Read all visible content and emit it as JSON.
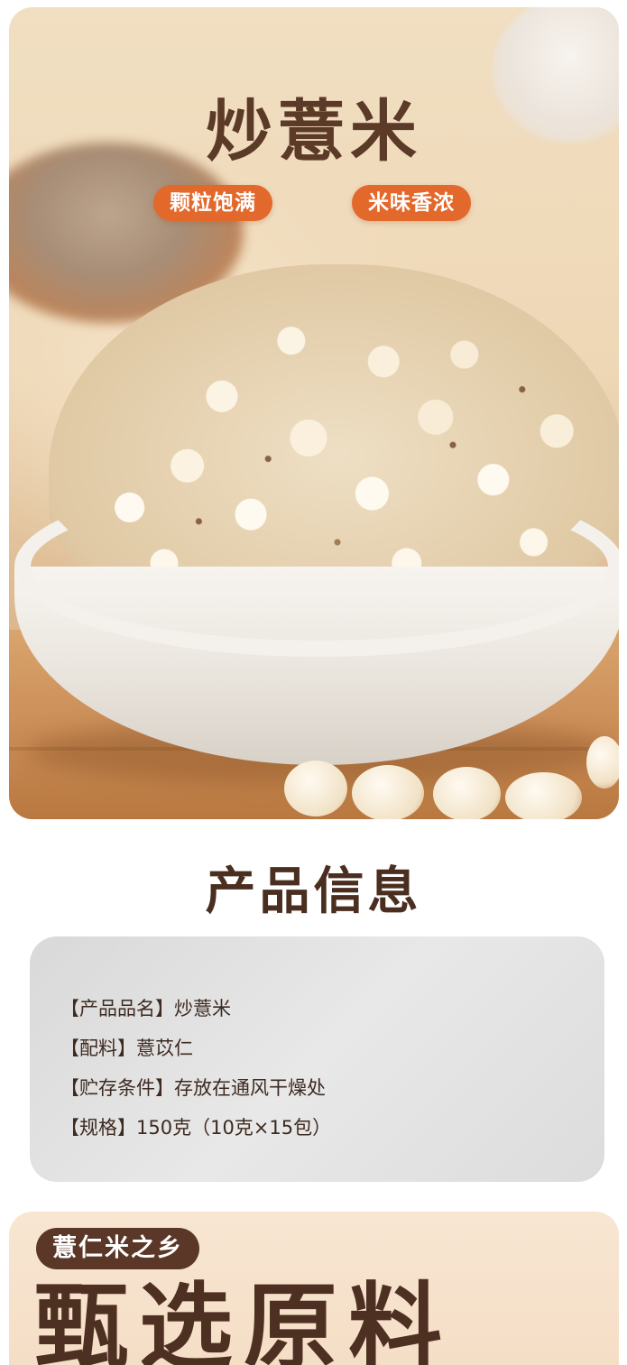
{
  "hero": {
    "title": "炒薏米",
    "tags": [
      "颗粒饱满",
      "米味香浓"
    ]
  },
  "product_info": {
    "title": "产品信息",
    "lines": [
      "【产品品名】炒薏米",
      "【配料】薏苡仁",
      "【贮存条件】存放在通风干燥处",
      "【规格】150克（10克×15包）"
    ]
  },
  "origin": {
    "badge": "薏仁米之乡",
    "heading": "甄选原料"
  },
  "colors": {
    "accent_orange": "#e2682b",
    "title_brown": "#5b3a27",
    "badge_brown": "#5a3727"
  }
}
